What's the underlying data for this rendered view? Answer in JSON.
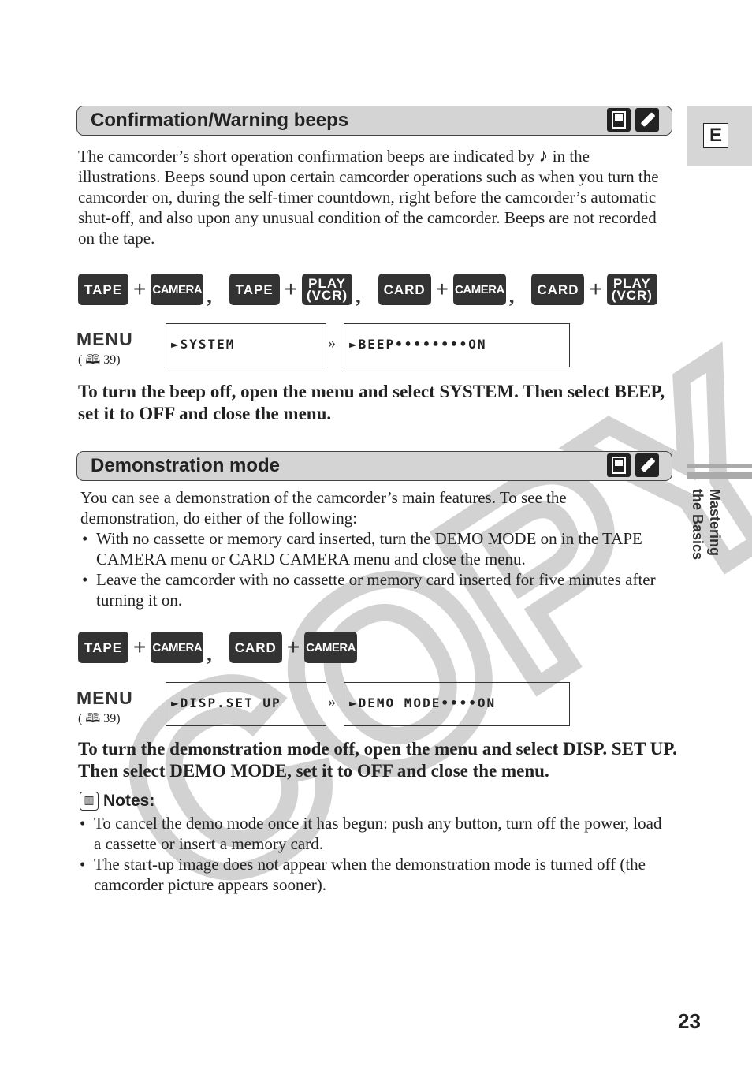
{
  "side_tab": {
    "letter": "E",
    "section": "Mastering the Basics"
  },
  "page_number": "23",
  "watermark": "COPY",
  "section1": {
    "title": "Confirmation/Warning beeps",
    "icons": [
      "camcorder-icon",
      "remote-control-icon"
    ],
    "body_before": "The camcorder’s short operation confirmation beeps are indicated by ",
    "note_symbol": "♪",
    "body_after": " in the illustrations. Beeps sound upon certain camcorder operations such as when you turn the camcorder on, during the self-timer countdown, right before the camcorder’s automatic shut-off, and also upon any unusual condition of the camcorder. Beeps are not recorded on the tape.",
    "modes": [
      [
        "TAPE",
        "CAMERA"
      ],
      [
        "TAPE",
        "PLAY (VCR)"
      ],
      [
        "CARD",
        "CAMERA"
      ],
      [
        "CARD",
        "PLAY (VCR)"
      ]
    ],
    "menu_label": "MENU",
    "menu_ref": "39",
    "menu_steps": [
      "►SYSTEM",
      "►BEEP••••••••ON"
    ],
    "instruction": "To turn the beep off, open the menu and select SYSTEM. Then select BEEP, set it to OFF and close the menu."
  },
  "section2": {
    "title": "Demonstration mode",
    "intro": "You can see a demonstration of the camcorder’s main features. To see the demonstration, do either of the following:",
    "bullets": [
      "With no cassette or memory card inserted, turn the DEMO MODE on in the TAPE CAMERA menu or CARD CAMERA menu and close the menu.",
      "Leave the camcorder with no cassette or memory card inserted for five minutes after turning it on."
    ],
    "modes": [
      [
        "TAPE",
        "CAMERA"
      ],
      [
        "CARD",
        "CAMERA"
      ]
    ],
    "menu_label": "MENU",
    "menu_ref": "39",
    "menu_steps": [
      "►DISP.SET UP",
      "►DEMO MODE••••ON"
    ],
    "instruction": "To turn the demonstration mode off, open the menu and select DISP. SET UP. Then select DEMO MODE, set it to OFF and close the menu."
  },
  "notes": {
    "title": "Notes:",
    "items": [
      "To cancel the demo mode once it has begun: push any button, turn off the power, load a cassette or insert a memory card.",
      "The start-up image does not appear when the demonstration mode is turned off (the camcorder picture appears sooner)."
    ]
  }
}
